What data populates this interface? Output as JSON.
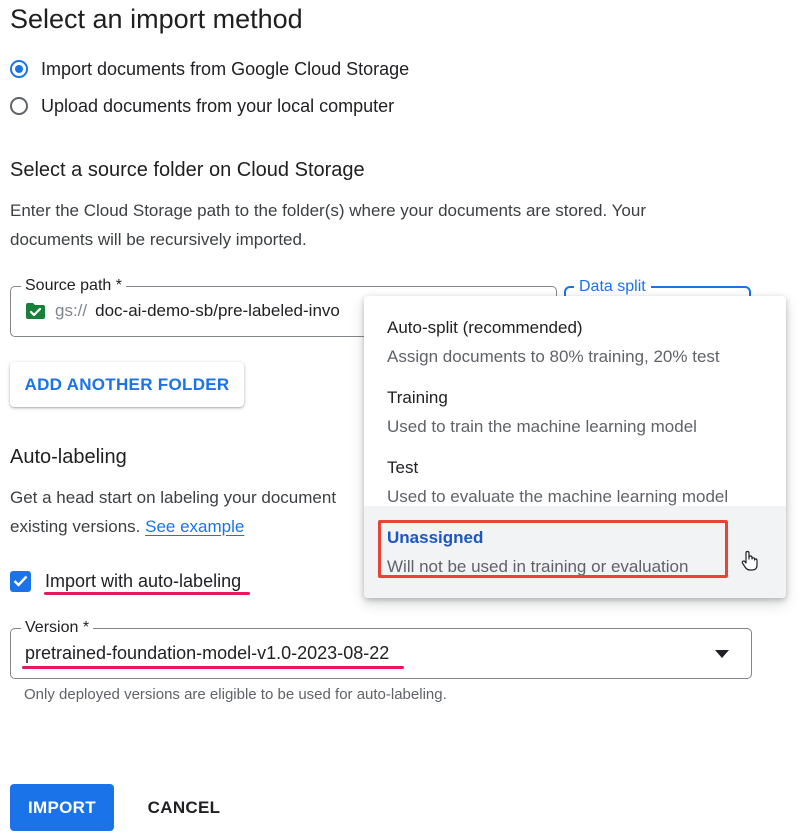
{
  "page_title": "Select an import method",
  "import_options": [
    {
      "label": "Import documents from Google Cloud Storage",
      "selected": true
    },
    {
      "label": "Upload documents from your local computer",
      "selected": false
    }
  ],
  "source": {
    "heading": "Select a source folder on Cloud Storage",
    "description_line1": "Enter the Cloud Storage path to the folder(s) where your documents are stored. Your",
    "description_line2": "documents will be recursively imported.",
    "path_label": "Source path *",
    "path_prefix": "gs://",
    "path_value": "doc-ai-demo-sb/pre-labeled-invo",
    "split_label": "Data split",
    "add_folder_label": "ADD ANOTHER FOLDER"
  },
  "split_menu": {
    "options": [
      {
        "title": "Auto-split (recommended)",
        "desc": "Assign documents to 80% training, 20% test"
      },
      {
        "title": "Training",
        "desc": "Used to train the machine learning model"
      },
      {
        "title": "Test",
        "desc": "Used to evaluate the machine learning model"
      },
      {
        "title": "Unassigned",
        "desc": "Will not be used in training or evaluation"
      }
    ]
  },
  "auto_labeling": {
    "heading": "Auto-labeling",
    "description_line1": "Get a head start on labeling your document",
    "description_line2_prefix": "existing versions.",
    "see_example": "See example",
    "checkbox_label": "Import with auto-labeling",
    "checked": true,
    "version_label": "Version *",
    "version_value": "pretrained-foundation-model-v1.0-2023-08-22",
    "helper": "Only deployed versions are eligible to be used for auto-labeling."
  },
  "actions": {
    "import_label": "IMPORT",
    "cancel_label": "CANCEL"
  },
  "colors": {
    "accent": "#1a73e8",
    "highlight_box": "#ea4335",
    "underline_annotation": "#e8175d"
  }
}
